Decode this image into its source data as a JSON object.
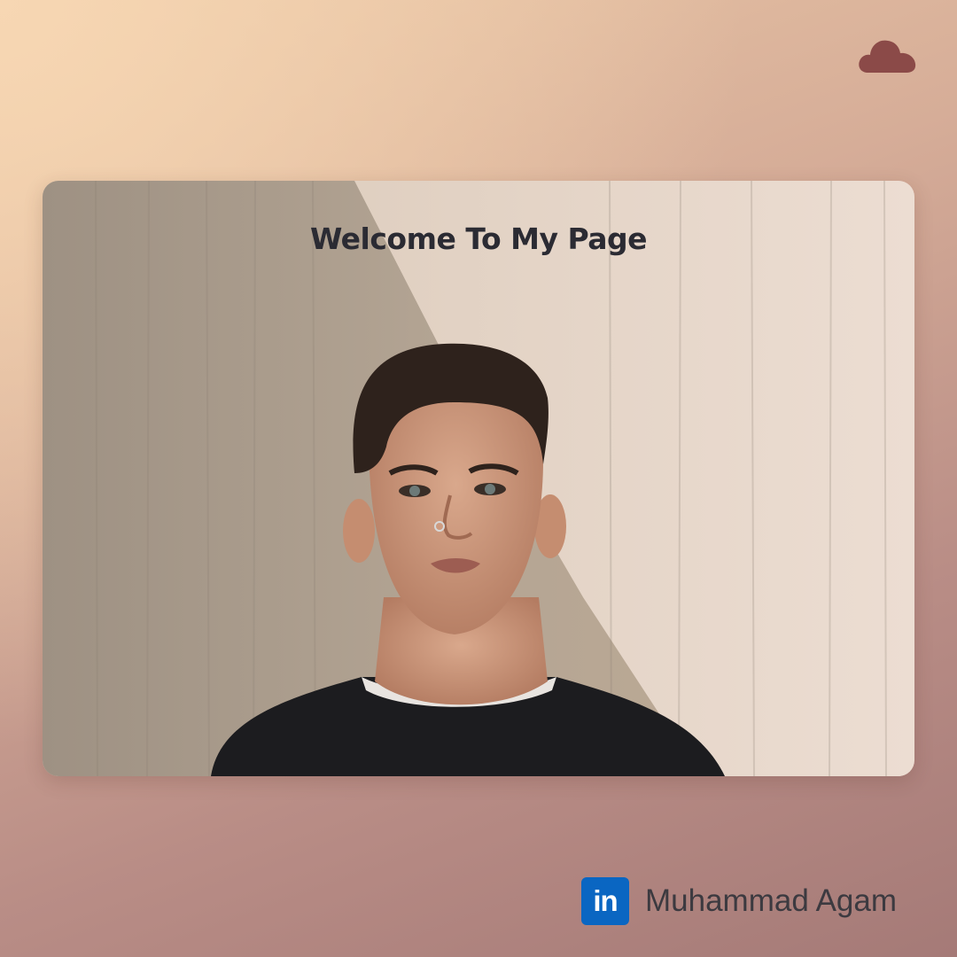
{
  "page": {
    "background_colors": [
      "#f7d7b3",
      "#d6ad98",
      "#a57a77"
    ]
  },
  "header": {
    "icon": "cloud-icon",
    "icon_color": "#8b4a48"
  },
  "hero": {
    "title": "Welcome To My Page",
    "image": "portrait-photo",
    "title_color": "#2b2b33"
  },
  "author": {
    "icon": "linkedin-icon",
    "icon_label": "in",
    "icon_color": "#0a66c2",
    "name": "Muhammad Agam"
  }
}
